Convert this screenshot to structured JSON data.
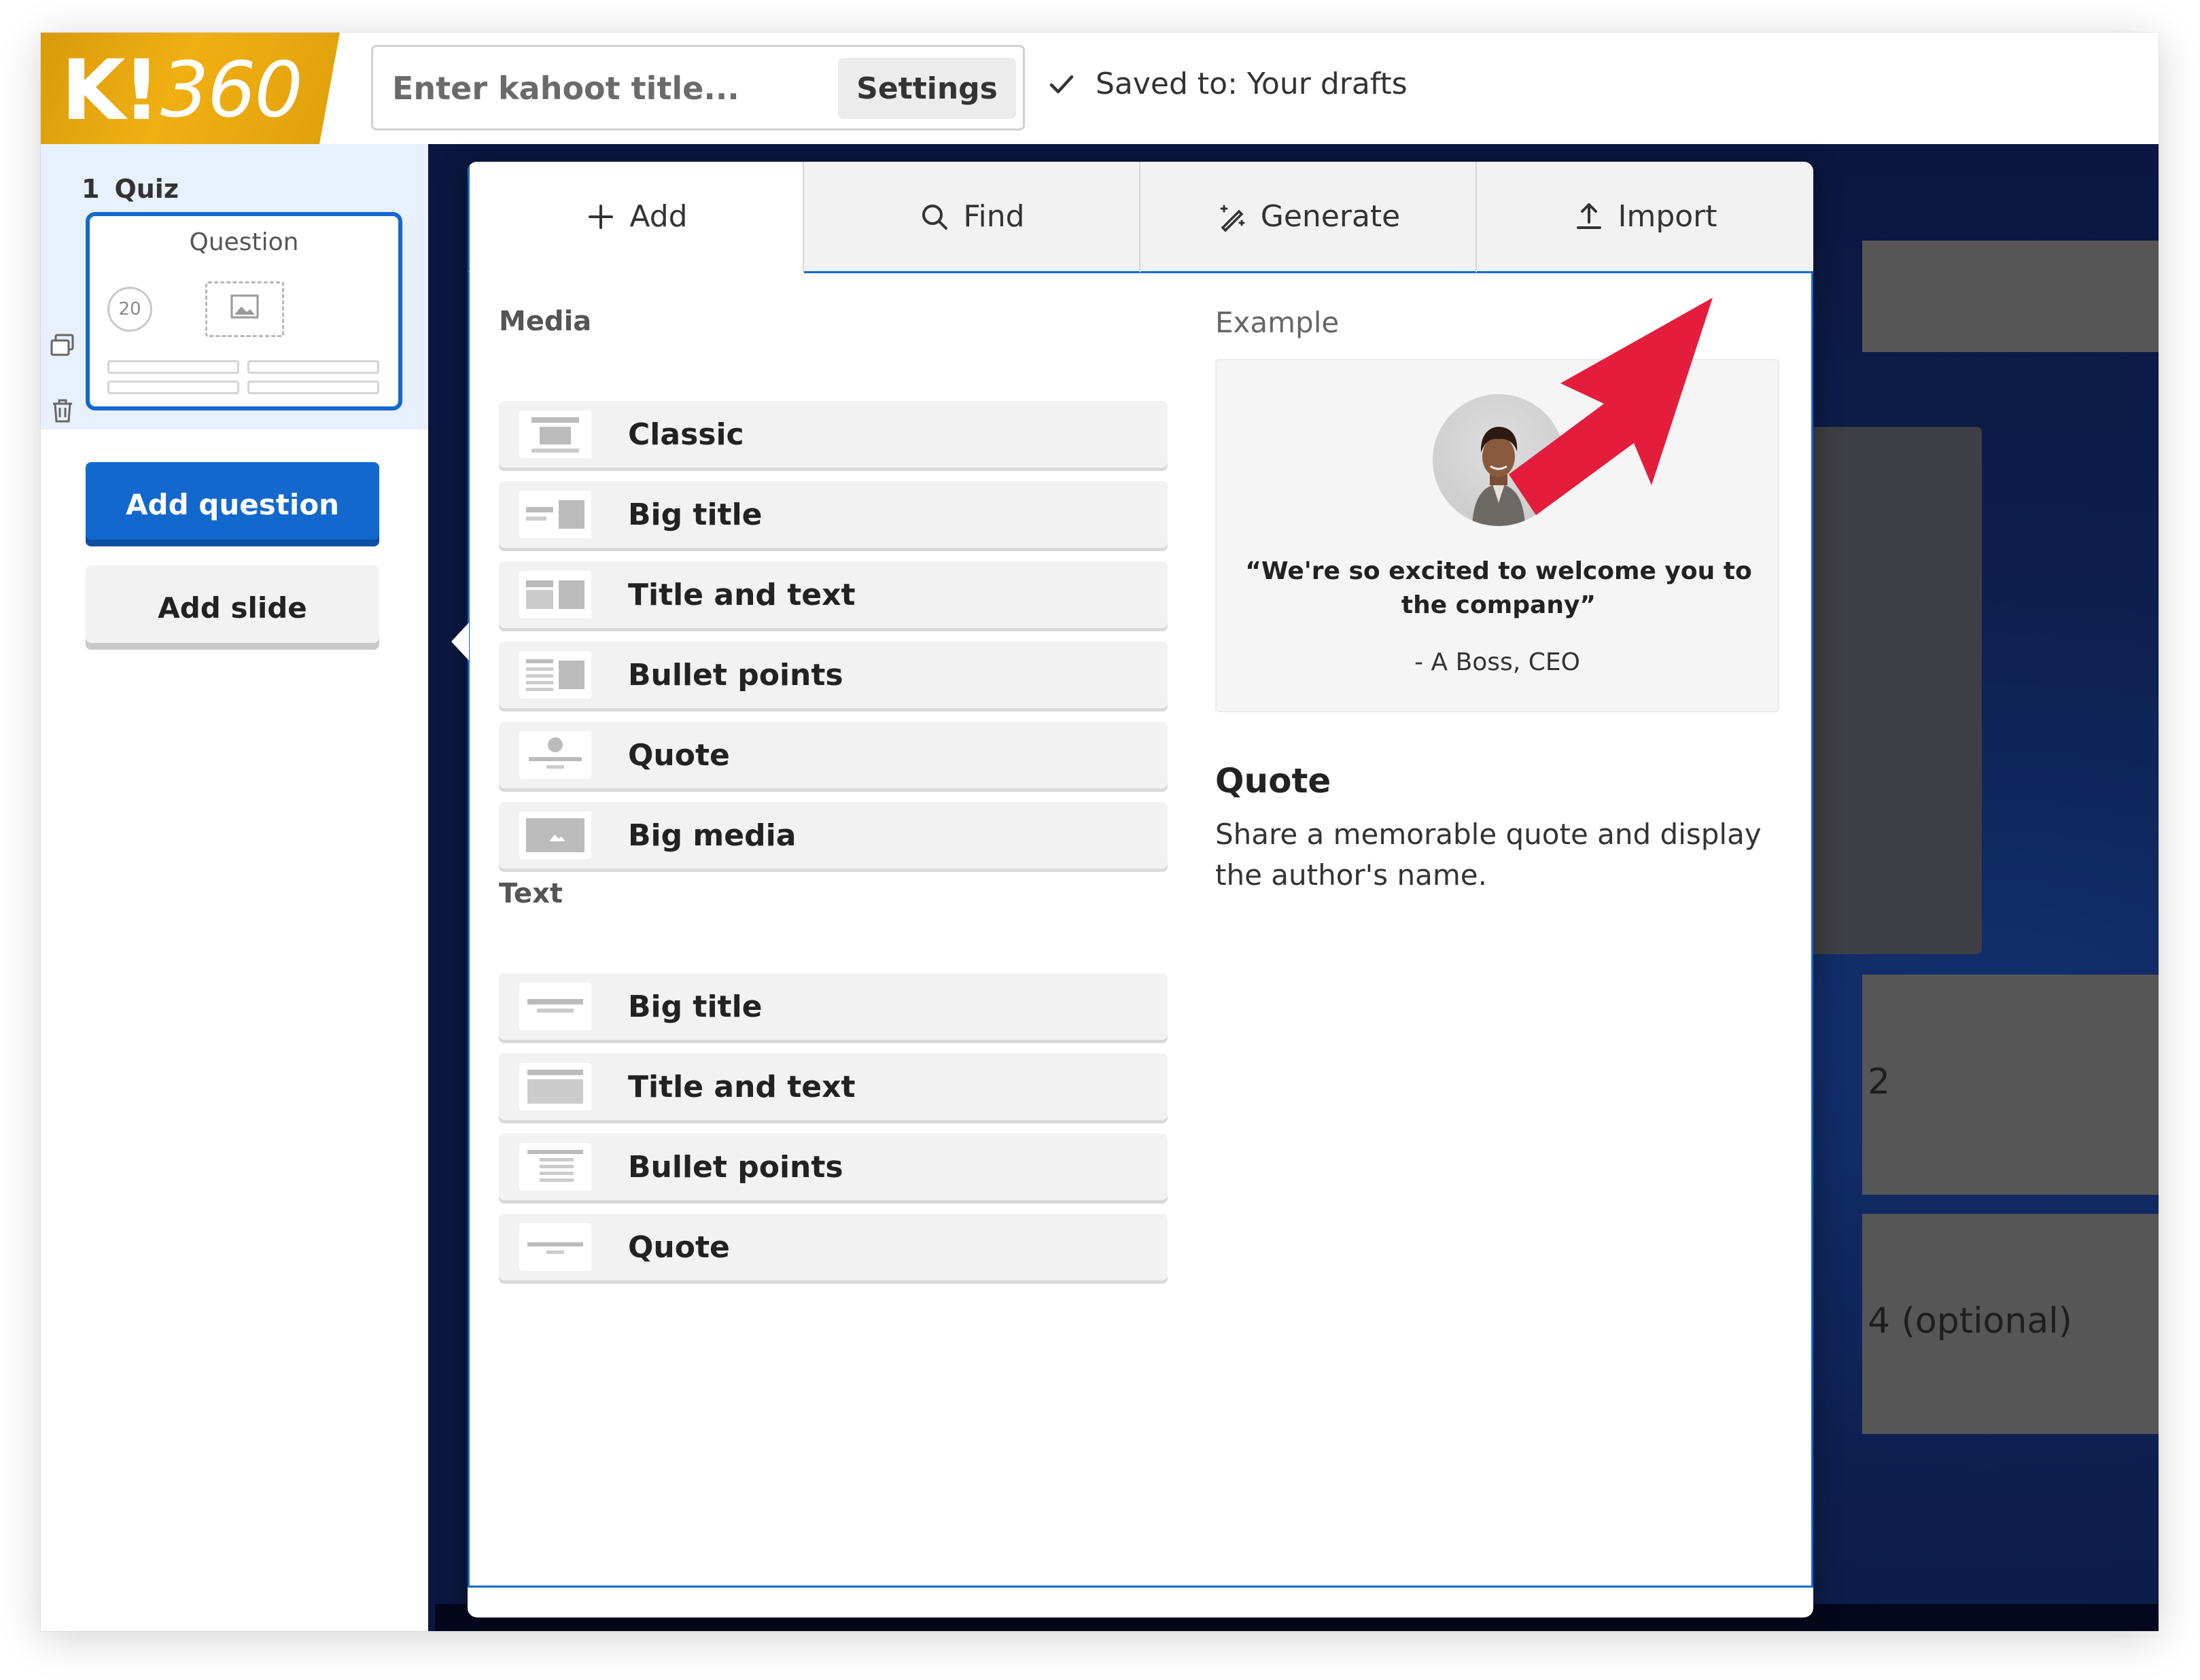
{
  "app": {
    "logo_k": "K!",
    "logo_360": "360",
    "title_placeholder": "Enter kahoot title...",
    "settings_label": "Settings",
    "saved_text": "Saved to: Your drafts"
  },
  "sidebar": {
    "slide_number": "1",
    "slide_type": "Quiz",
    "thumbnail_title": "Question",
    "thumbnail_timer": "20",
    "add_question_label": "Add question",
    "add_slide_label": "Add slide"
  },
  "canvas": {
    "answer_2": "2",
    "answer_4": "4 (optional)"
  },
  "modal": {
    "tabs": [
      {
        "label": "Add",
        "icon": "plus-icon"
      },
      {
        "label": "Find",
        "icon": "search-icon"
      },
      {
        "label": "Generate",
        "icon": "magic-wand-icon"
      },
      {
        "label": "Import",
        "icon": "upload-icon"
      }
    ],
    "media_section": "Media",
    "media_items": [
      {
        "label": "Classic",
        "icon": "layout-classic-icon"
      },
      {
        "label": "Big title",
        "icon": "layout-big-title-icon"
      },
      {
        "label": "Title and text",
        "icon": "layout-title-text-icon"
      },
      {
        "label": "Bullet points",
        "icon": "layout-bullets-icon"
      },
      {
        "label": "Quote",
        "icon": "layout-quote-icon"
      },
      {
        "label": "Big media",
        "icon": "layout-big-media-icon"
      }
    ],
    "text_section": "Text",
    "text_items": [
      {
        "label": "Big title",
        "icon": "layout-text-big-title-icon"
      },
      {
        "label": "Title and text",
        "icon": "layout-text-title-text-icon"
      },
      {
        "label": "Bullet points",
        "icon": "layout-text-bullets-icon"
      },
      {
        "label": "Quote",
        "icon": "layout-text-quote-icon"
      }
    ],
    "example_label": "Example",
    "example_quote": "“We're so excited to welcome you to the company”",
    "example_author": "- A Boss, CEO",
    "example_title": "Quote",
    "example_description": "Share a memorable quote and display the author's name."
  },
  "colors": {
    "brand_blue": "#1368ce",
    "logo_gold": "#f0b012",
    "arrow_red": "#e41d3d",
    "canvas_navy": "#0d1f4f"
  }
}
